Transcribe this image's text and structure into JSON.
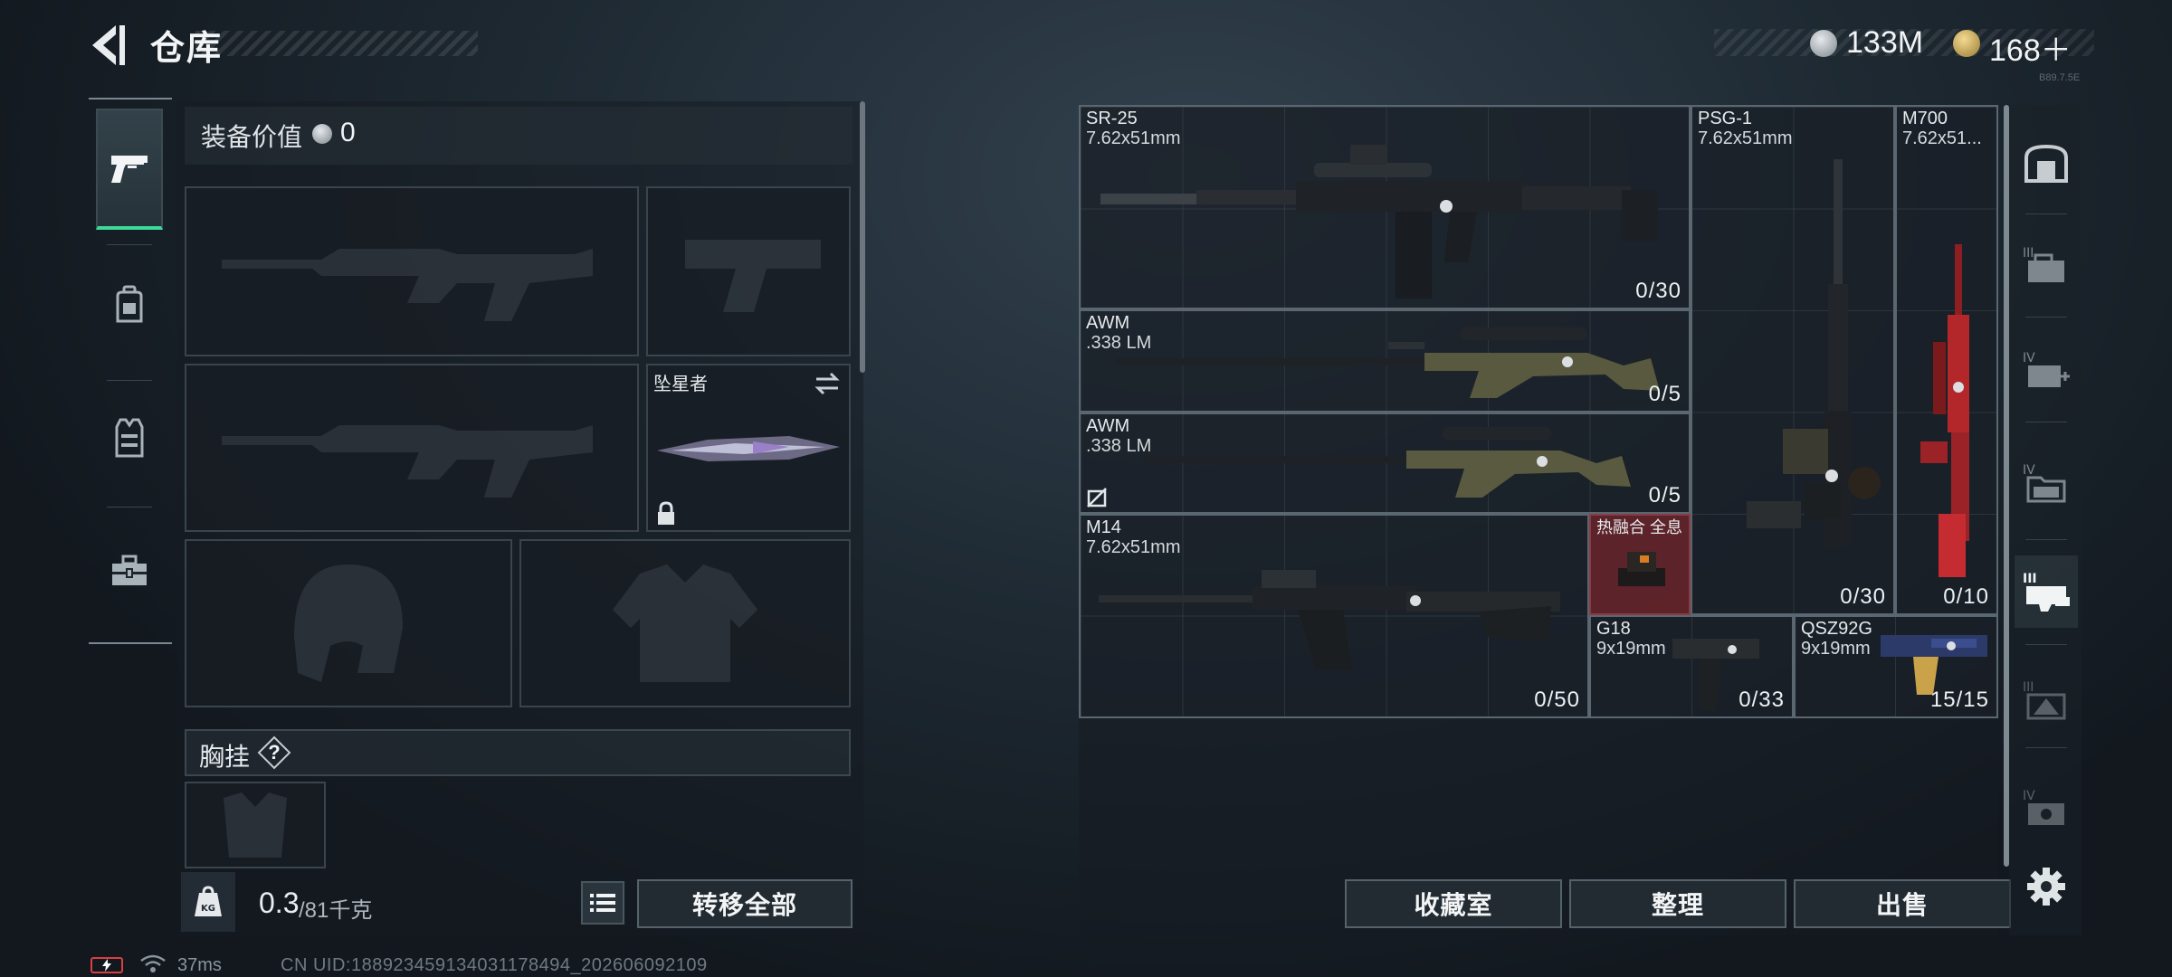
{
  "header": {
    "title": "仓库",
    "currency_silver": "133M",
    "currency_gold": "168＋",
    "build_tag": "B89.7.5E"
  },
  "nav": {
    "items": [
      "pistol-icon",
      "backpack-icon",
      "vest-icon",
      "toolbox-icon"
    ],
    "active": "pistol-icon"
  },
  "loadout": {
    "equipment_value_label": "装备价值",
    "equipment_value": "0",
    "melee_name": "坠星者",
    "chest_rig_label": "胸挂",
    "chest_rig_help": "?",
    "weight_current": "0.3",
    "weight_max": "/81千克",
    "weight_icon_text": "KG",
    "transfer_all": "转移全部"
  },
  "stash": {
    "items": [
      {
        "name": "SR-25",
        "caliber": "7.62x51mm",
        "ammo": "0/30"
      },
      {
        "name": "PSG-1",
        "caliber": "7.62x51mm",
        "ammo": "0/30"
      },
      {
        "name": "M700",
        "caliber": "7.62x51...",
        "ammo": "0/10"
      },
      {
        "name": "AWM",
        "caliber": ".338 LM",
        "ammo": "0/5"
      },
      {
        "name": "AWM",
        "caliber": ".338 LM",
        "ammo": "0/5"
      },
      {
        "name": "M14",
        "caliber": "7.62x51mm",
        "ammo": "0/50"
      },
      {
        "name": "热融合 全息",
        "caliber": "",
        "ammo": ""
      },
      {
        "name": "G18",
        "caliber": "9x19mm",
        "ammo": "0/33"
      },
      {
        "name": "QSZ92G",
        "caliber": "9x19mm",
        "ammo": "15/15"
      }
    ],
    "buttons": {
      "collection": "收藏室",
      "sort": "整理",
      "sell": "出售"
    }
  },
  "right_nav": {
    "items": [
      "safe-box-icon",
      "tier3-container-icon",
      "tier4-medkit-icon",
      "tier4-folder-icon",
      "tier3-weapon-case-icon",
      "tier3-crate-icon",
      "tier4-box-icon"
    ],
    "active": "tier3-weapon-case-icon"
  },
  "status": {
    "ping": "37ms",
    "uid": "CN UID:18892345913403​1178494_202606092109"
  },
  "colors": {
    "accent_green": "#3ed99a",
    "red_item": "#6e242a"
  }
}
